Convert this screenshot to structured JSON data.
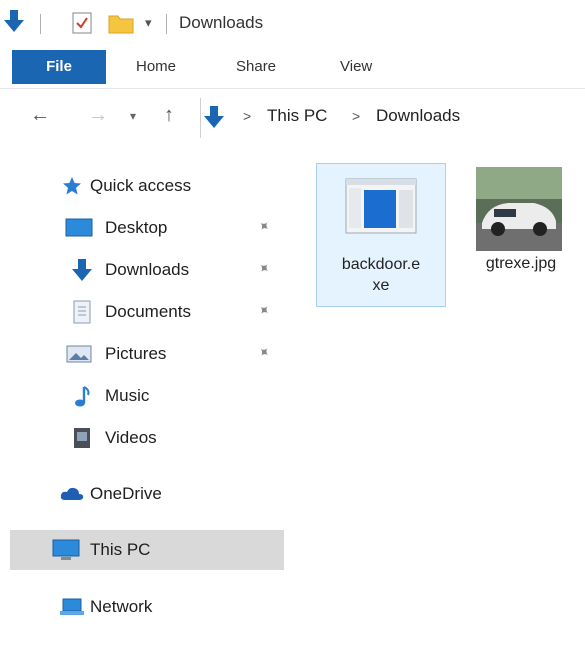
{
  "window": {
    "title": "Downloads"
  },
  "ribbon": {
    "tabs": [
      {
        "label": "File",
        "active": true
      },
      {
        "label": "Home"
      },
      {
        "label": "Share"
      },
      {
        "label": "View"
      }
    ]
  },
  "address": {
    "crumbs": [
      "This PC",
      "Downloads"
    ],
    "separator": ">"
  },
  "nav_pane": {
    "quick_access": {
      "label": "Quick access",
      "icon": "star-icon"
    },
    "items": [
      {
        "label": "Desktop",
        "icon": "desktop-icon",
        "pinned": true
      },
      {
        "label": "Downloads",
        "icon": "download-arrow-icon",
        "pinned": true
      },
      {
        "label": "Documents",
        "icon": "documents-icon",
        "pinned": true
      },
      {
        "label": "Pictures",
        "icon": "pictures-icon",
        "pinned": true
      },
      {
        "label": "Music",
        "icon": "music-icon",
        "pinned": false
      },
      {
        "label": "Videos",
        "icon": "videos-icon",
        "pinned": false
      }
    ],
    "onedrive": {
      "label": "OneDrive",
      "icon": "cloud-icon"
    },
    "this_pc": {
      "label": "This PC",
      "icon": "computer-icon",
      "selected": true
    },
    "network": {
      "label": "Network",
      "icon": "network-icon"
    }
  },
  "files": [
    {
      "name_line1": "backdoor.e",
      "name_line2": "xe",
      "type": "application",
      "selected": true
    },
    {
      "name_line1": "gtrexe.jpg",
      "type": "image"
    }
  ],
  "colors": {
    "accent": "#1a66b3",
    "selection_bg": "#e5f3ff",
    "selection_border": "#a9d1f5",
    "nav_selected_bg": "#d9d9d9"
  }
}
